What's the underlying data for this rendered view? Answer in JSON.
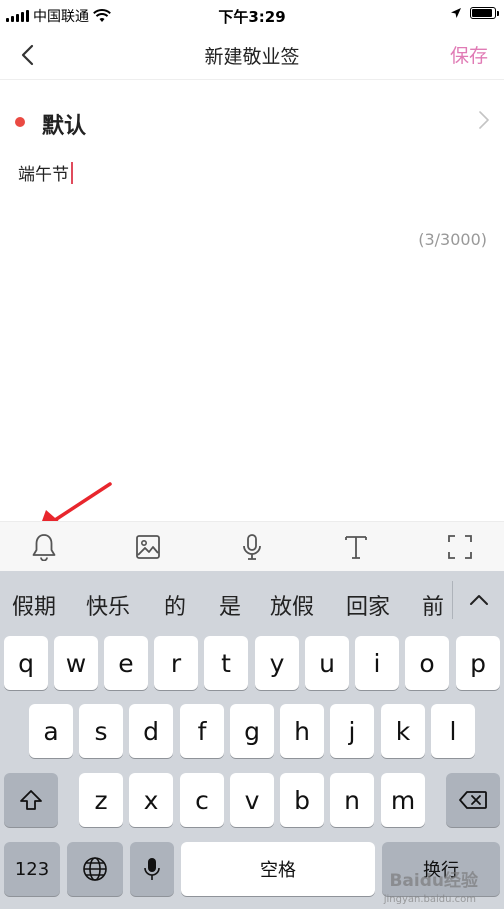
{
  "status_bar": {
    "carrier": "中国联通",
    "time": "下午3:29",
    "battery_level": 0.9
  },
  "nav": {
    "title": "新建敬业签",
    "save_label": "保存"
  },
  "category": {
    "label": "默认",
    "dot_color": "#ea4a42"
  },
  "note": {
    "content": "端午节",
    "char_count": "(3/3000)"
  },
  "toolbar": {
    "icons": [
      "bell-icon",
      "image-icon",
      "microphone-icon",
      "text-format-icon",
      "fullscreen-icon"
    ]
  },
  "keyboard": {
    "candidates": [
      "假期",
      "快乐",
      "的",
      "是",
      "放假",
      "回家",
      "前"
    ],
    "row1": [
      "q",
      "w",
      "e",
      "r",
      "t",
      "y",
      "u",
      "i",
      "o",
      "p"
    ],
    "row2": [
      "a",
      "s",
      "d",
      "f",
      "g",
      "h",
      "j",
      "k",
      "l"
    ],
    "row3": [
      "z",
      "x",
      "c",
      "v",
      "b",
      "n",
      "m"
    ],
    "numbers_label": "123",
    "space_label": "空格",
    "return_label": "换行"
  },
  "watermark": {
    "text": "Baidu经验",
    "sub": "jingyan.baidu.com"
  },
  "colors": {
    "accent": "#e07bb5",
    "cursor": "#e04b5c",
    "keyboard_bg": "#d1d5db"
  }
}
